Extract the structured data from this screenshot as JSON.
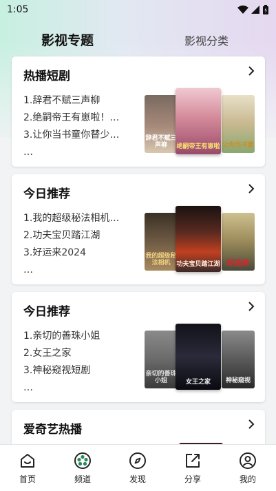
{
  "status": {
    "time": "1:05"
  },
  "tabs": {
    "active": "影视专题",
    "inactive": "影视分类"
  },
  "cards": [
    {
      "title": "热播短剧",
      "items": [
        "1.辞君不赋三声柳",
        "2.绝嗣帝王有崽啦！…",
        "3.让你当书童你替少…",
        "…"
      ],
      "poster_texts": [
        "辞君不赋三声柳",
        "绝嗣帝王有崽啦",
        "让你当书童"
      ],
      "poster_colors": [
        "#a78a7a",
        "#d48a9a",
        "#c8b890"
      ]
    },
    {
      "title": "今日推荐",
      "items": [
        "1.我的超级秘法相机…",
        "2.功夫宝贝踏江湖",
        "3.好运来2024",
        "…"
      ],
      "poster_texts": [
        "我的超级秘法相机",
        "功夫宝贝踏江湖",
        "好运来"
      ],
      "poster_colors": [
        "#6f5a44",
        "#3a2a2a",
        "#9a8a5a"
      ]
    },
    {
      "title": "今日推荐",
      "items": [
        "1.亲切的善珠小姐",
        "2.女王之家",
        "3.神秘窥视短剧",
        "…"
      ],
      "poster_texts": [
        "亲切的善珠小姐",
        "女王之家",
        "神秘窥视"
      ],
      "poster_colors": [
        "#6a6a6a",
        "#2a2a3a",
        "#5a5a5a"
      ]
    },
    {
      "title": "爱奇艺热播",
      "items": [],
      "poster_texts": [],
      "poster_colors": []
    }
  ],
  "nav": [
    {
      "label": "首页",
      "icon": "home-icon"
    },
    {
      "label": "频道",
      "icon": "film-reel-icon"
    },
    {
      "label": "发现",
      "icon": "compass-icon"
    },
    {
      "label": "分享",
      "icon": "share-icon"
    },
    {
      "label": "我的",
      "icon": "user-icon"
    }
  ]
}
